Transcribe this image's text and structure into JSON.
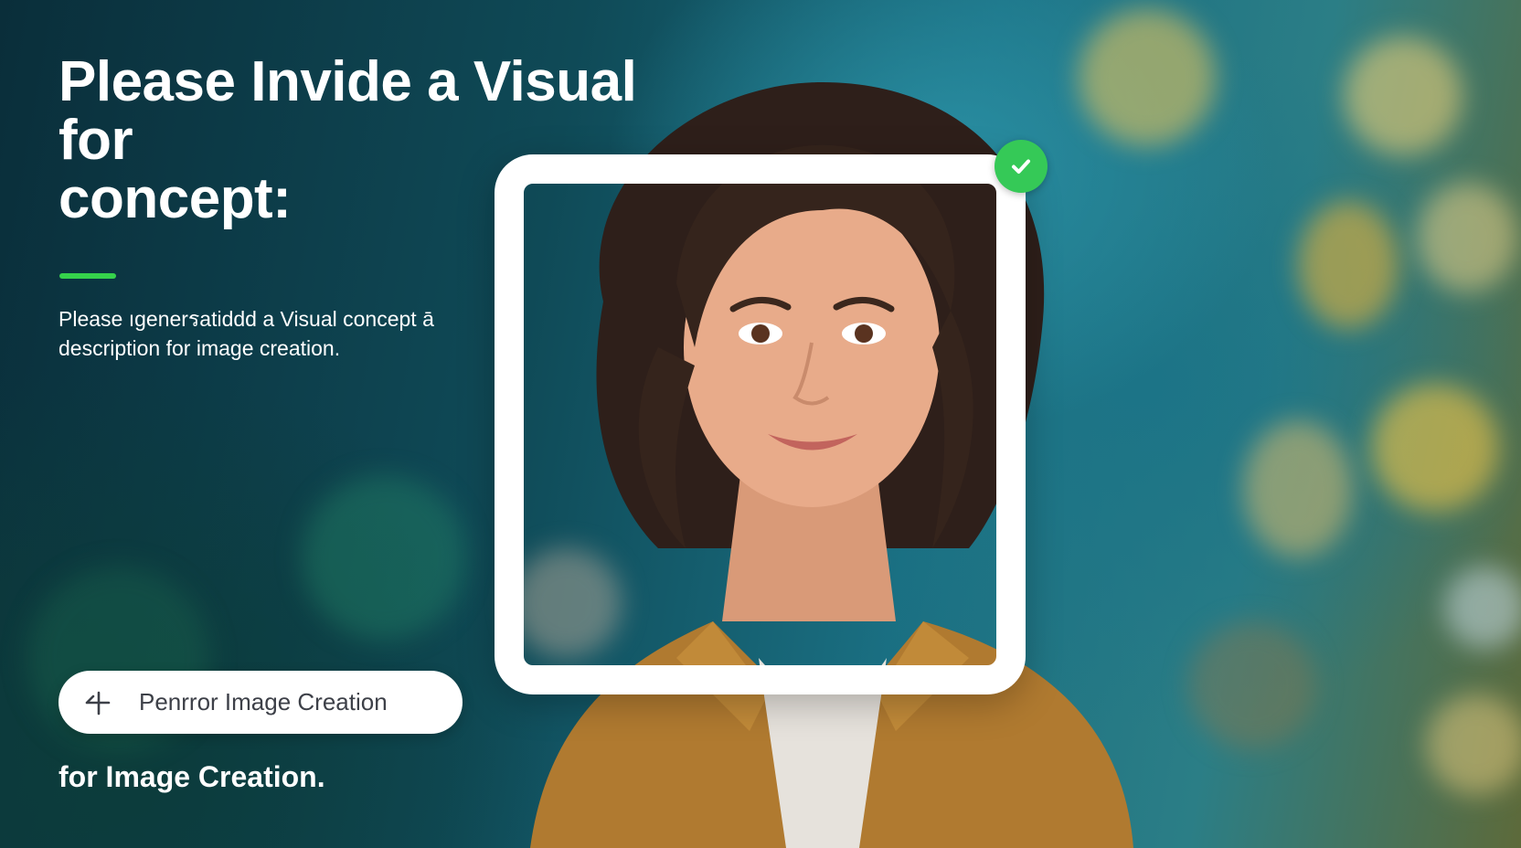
{
  "hero": {
    "headline_lines": [
      "Please Invide a Visual",
      "for",
      "concept:"
    ],
    "description_lines": [
      "Please ıgenerรatiddd a Visual concept ā",
      "description for image creation."
    ],
    "accent_color": "#35d24b"
  },
  "photo_card": {
    "subject": "portrait-photo",
    "badge_icon": "check-icon",
    "badge_color": "#35c957"
  },
  "cta": {
    "icon": "plus-icon",
    "label": "Penrror Image Creation"
  },
  "footer": {
    "text": "for Image Creation."
  }
}
